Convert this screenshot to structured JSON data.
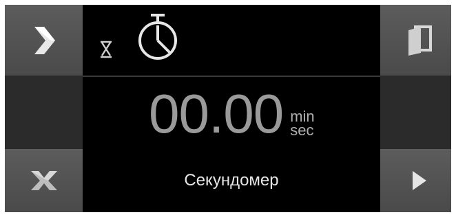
{
  "timer": {
    "time": "00.00",
    "unit_top": "min",
    "unit_bottom": "sec"
  },
  "mode": {
    "label": "Секундомер"
  },
  "icons": {
    "nav_next": "chevron-right-icon",
    "exit": "door-exit-icon",
    "cancel": "x-icon",
    "play": "play-icon",
    "hourglass": "hourglass-icon",
    "stopwatch": "stopwatch-icon"
  },
  "colors": {
    "background": "#000000",
    "button": "#555555",
    "time_text": "#9a9a9a"
  }
}
